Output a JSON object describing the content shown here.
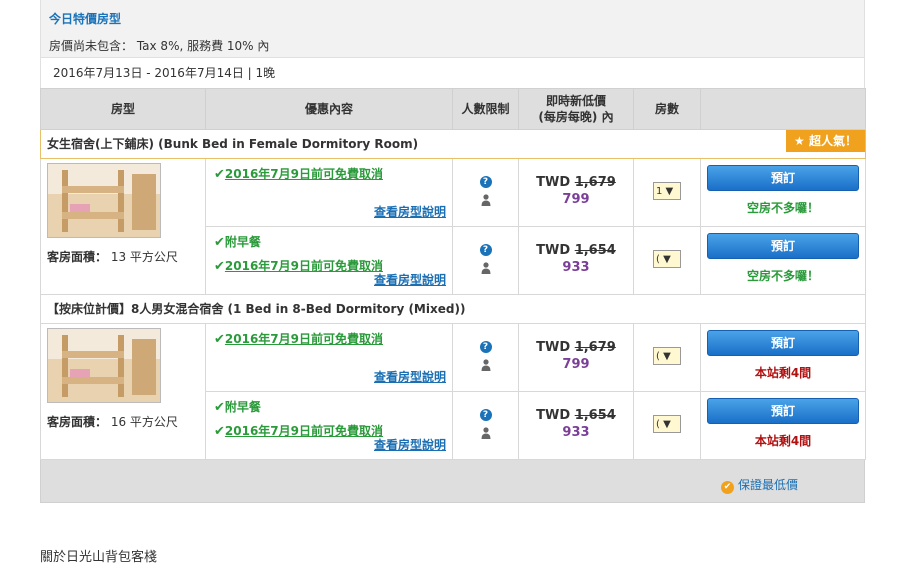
{
  "header": {
    "title": "今日特價房型",
    "tax_note": "房價尚未包含： Tax 8%, 服務費 10% 內",
    "date_range": "2016年7月13日 - 2016年7月14日 | 1晚"
  },
  "columns": [
    "房型",
    "優惠內容",
    "人數限制",
    "即時新低價\n(每房每晚) 內",
    "房數"
  ],
  "columns_price_line1": "即時新低價",
  "columns_price_line2": "(每房每晚) 內",
  "rooms": [
    {
      "title": "女生宿舍(上下鋪床) (Bunk Bed in Female Dormitory Room)",
      "badge": "超人氣！",
      "area_label": "客房面積：",
      "area_value": "13 平方公尺",
      "offers": [
        {
          "lines": [
            "2016年7月9日前可免費取消"
          ],
          "more": "查看房型說明",
          "currency": "TWD",
          "original": "1,679",
          "price": "799",
          "qty": "1",
          "book": "預訂",
          "avail": "空房不多囉！",
          "avail_color": "#2a9a3a"
        },
        {
          "lines": [
            "附早餐",
            "2016年7月9日前可免費取消"
          ],
          "more": "查看房型說明",
          "currency": "TWD",
          "original": "1,654",
          "price": "933",
          "qty": "(",
          "book": "預訂",
          "avail": "空房不多囉！",
          "avail_color": "#2a9a3a"
        }
      ]
    },
    {
      "title": "【按床位計價】8人男女混合宿舍 (1 Bed in 8-Bed Dormitory (Mixed))",
      "badge": "",
      "area_label": "客房面積：",
      "area_value": "16 平方公尺",
      "offers": [
        {
          "lines": [
            "2016年7月9日前可免費取消"
          ],
          "more": "查看房型說明",
          "currency": "TWD",
          "original": "1,679",
          "price": "799",
          "qty": "(",
          "book": "預訂",
          "avail": "本站剩4間",
          "avail_color": "#b01010"
        },
        {
          "lines": [
            "附早餐",
            "2016年7月9日前可免費取消"
          ],
          "more": "查看房型說明",
          "currency": "TWD",
          "original": "1,654",
          "price": "933",
          "qty": "(",
          "book": "預訂",
          "avail": "本站剩4間",
          "avail_color": "#b01010"
        }
      ]
    }
  ],
  "footer": {
    "guarantee": "保證最低價"
  },
  "about": "關於日光山背包客棧"
}
